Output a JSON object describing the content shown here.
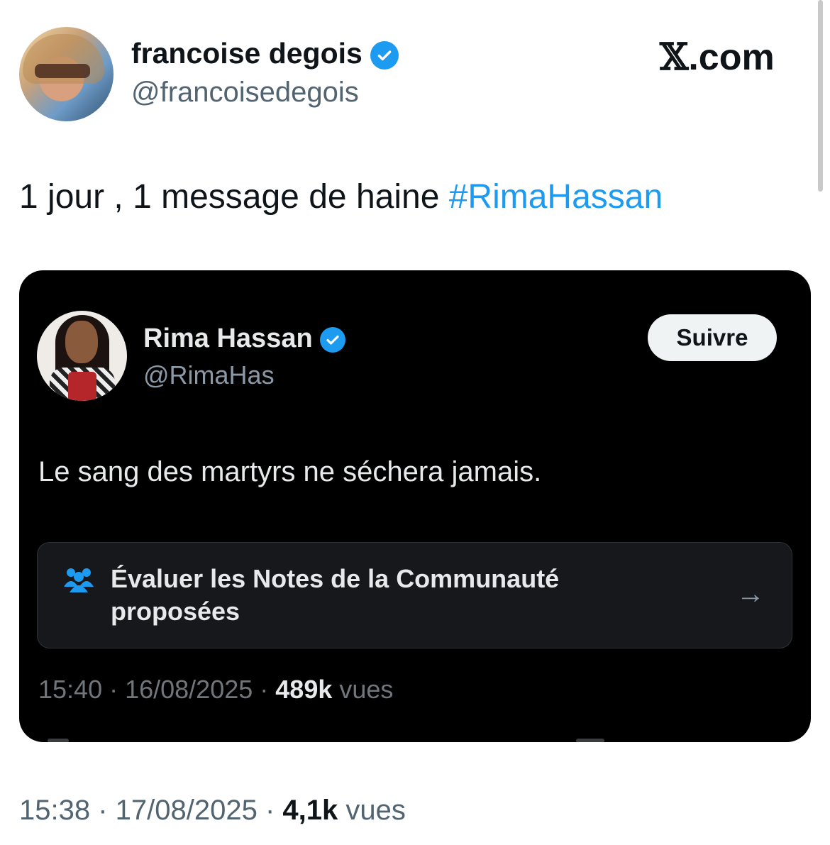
{
  "brand": {
    "prefix": "𝕏",
    "suffix": ".com"
  },
  "author": {
    "name": "francoise degois",
    "handle": "@francoisedegois",
    "verified": true
  },
  "tweet": {
    "text": "1 jour , 1 message de haine ",
    "hashtag": "#RimaHassan"
  },
  "quoted": {
    "name": "Rima Hassan",
    "handle": "@RimaHas",
    "verified": true,
    "follow_label": "Suivre",
    "text": "Le sang des martyrs ne séchera jamais.",
    "notes_line1": "Évaluer les Notes de la Communauté",
    "notes_line2": "proposées",
    "notes_arrow": "→",
    "time": "15:40",
    "date": "16/08/2025",
    "views_count": "489k",
    "views_label": "vues"
  },
  "meta": {
    "time": "15:38",
    "date": "17/08/2025",
    "views_count": "4,1k",
    "views_label": "vues",
    "separator": " · "
  },
  "colors": {
    "accent": "#1d9bf0",
    "card_bg": "#000000",
    "secondary_text": "#536471"
  }
}
